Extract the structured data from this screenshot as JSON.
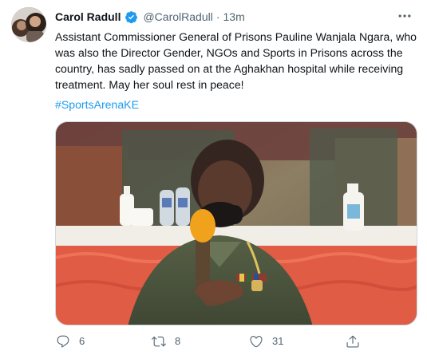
{
  "tweet": {
    "display_name": "Carol Radull",
    "handle": "@CarolRadull",
    "separator": "·",
    "time": "13m",
    "text": "Assistant Commissioner General of Prisons Pauline Wanjala Ngara, who was also the Director Gender, NGOs and Sports in Prisons across the country, has sadly passed on at the Aghakhan hospital while receiving treatment. May her soul rest in peace!",
    "hashtag": "#SportsArenaKE",
    "media_type": "photo",
    "counts": {
      "replies": "6",
      "retweets": "8",
      "likes": "31"
    },
    "icons": {
      "verified": "verified-badge-icon",
      "more": "more-icon",
      "reply": "reply-icon",
      "retweet": "retweet-icon",
      "like": "heart-icon",
      "share": "share-icon"
    },
    "colors": {
      "text_primary": "#0f1419",
      "text_secondary": "#536471",
      "accent": "#1d9bf0",
      "border": "#cfd9de"
    }
  }
}
